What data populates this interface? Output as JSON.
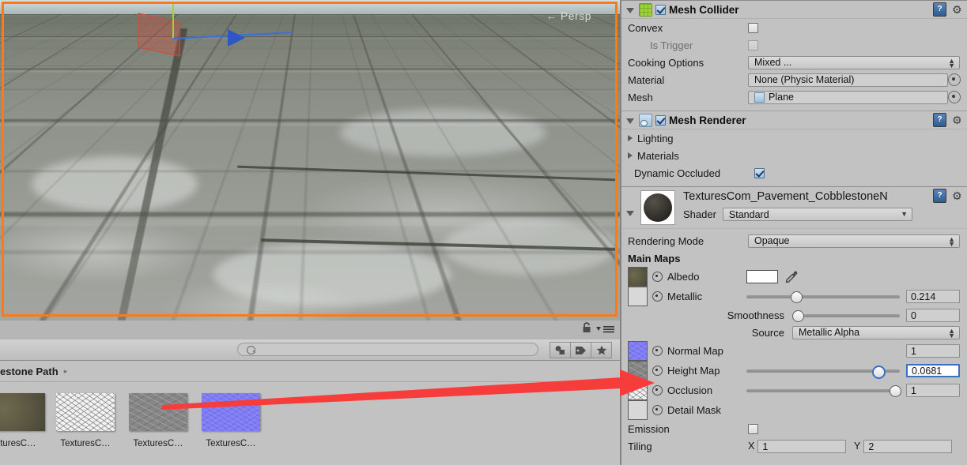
{
  "scene": {
    "perspective_label": "Persp",
    "perspective_arrow": "←",
    "selection_color": "#ff7a16",
    "gizmo": {
      "x_color": "#d64a38",
      "y_color": "#a7d22b",
      "z_color": "#3d6fd8"
    }
  },
  "project": {
    "search_placeholder": "",
    "breadcrumb": "estone Path",
    "breadcrumb_arrow": "▸",
    "lock_icon": "lock-icon",
    "menu_icon": "menu-icon",
    "filters": [
      {
        "name": "filter-by-type",
        "glyph": "▲"
      },
      {
        "name": "filter-by-label",
        "glyph": "◆"
      },
      {
        "name": "filter-by-favorite",
        "glyph": "★"
      }
    ],
    "assets": [
      {
        "label": "xturesC…",
        "kind": "albedo-texture"
      },
      {
        "label": "TexturesC…",
        "kind": "occlusion-texture"
      },
      {
        "label": "TexturesC…",
        "kind": "height-texture"
      },
      {
        "label": "TexturesC…",
        "kind": "normal-texture"
      }
    ]
  },
  "inspector": {
    "mesh_collider": {
      "title": "Mesh Collider",
      "enabled": true,
      "rows": {
        "convex_label": "Convex",
        "convex_checked": false,
        "is_trigger_label": "Is Trigger",
        "is_trigger_checked": false,
        "cooking_options_label": "Cooking Options",
        "cooking_options_value": "Mixed ...",
        "material_label": "Material",
        "material_value": "None (Physic Material)",
        "mesh_label": "Mesh",
        "mesh_value": "Plane"
      }
    },
    "mesh_renderer": {
      "title": "Mesh Renderer",
      "enabled": true,
      "lighting_label": "Lighting",
      "materials_label": "Materials",
      "dynamic_occluded_label": "Dynamic Occluded",
      "dynamic_occluded_checked": true
    },
    "material": {
      "name": "TexturesCom_Pavement_CobblestoneN",
      "shader_label": "Shader",
      "shader_value": "Standard",
      "rendering_mode_label": "Rendering Mode",
      "rendering_mode_value": "Opaque",
      "main_maps_label": "Main Maps",
      "maps": [
        {
          "name": "Albedo",
          "label": "◉ Albedo",
          "swatch": "albedo",
          "control": "color",
          "color_value": "#ffffff"
        },
        {
          "name": "Metallic",
          "label": "◉ Metallic",
          "swatch": "empty",
          "control": "slider",
          "value": "0.214",
          "pct": 30
        },
        {
          "name": "Smoothness",
          "label": "Smoothness",
          "swatch": "none",
          "control": "slider",
          "value": "0",
          "pct": 0
        },
        {
          "name": "Source",
          "label": "Source",
          "swatch": "none",
          "control": "dropdown",
          "value": "Metallic Alpha"
        },
        {
          "name": "Normal Map",
          "label": "◉ Normal Map",
          "swatch": "normal",
          "control": "number",
          "value": "1"
        },
        {
          "name": "Height Map",
          "label": "◉ Height Map",
          "swatch": "height",
          "control": "slider",
          "value": "0.0681",
          "pct": 84,
          "focused": true
        },
        {
          "name": "Occlusion",
          "label": "◉ Occlusion",
          "swatch": "occlusion",
          "control": "slider",
          "value": "1",
          "pct": 100
        },
        {
          "name": "Detail Mask",
          "label": "◉ Detail Mask",
          "swatch": "empty",
          "control": "none"
        }
      ],
      "emission_label": "Emission",
      "emission_checked": false,
      "tiling_label": "Tiling",
      "tiling_x_axis": "X",
      "tiling_x": "1",
      "tiling_y_axis": "Y",
      "tiling_y": "2"
    },
    "help_icon_glyph": "?",
    "gear_icon_glyph": "⚙"
  },
  "annotation": {
    "arrow_color": "#f73c3c"
  }
}
